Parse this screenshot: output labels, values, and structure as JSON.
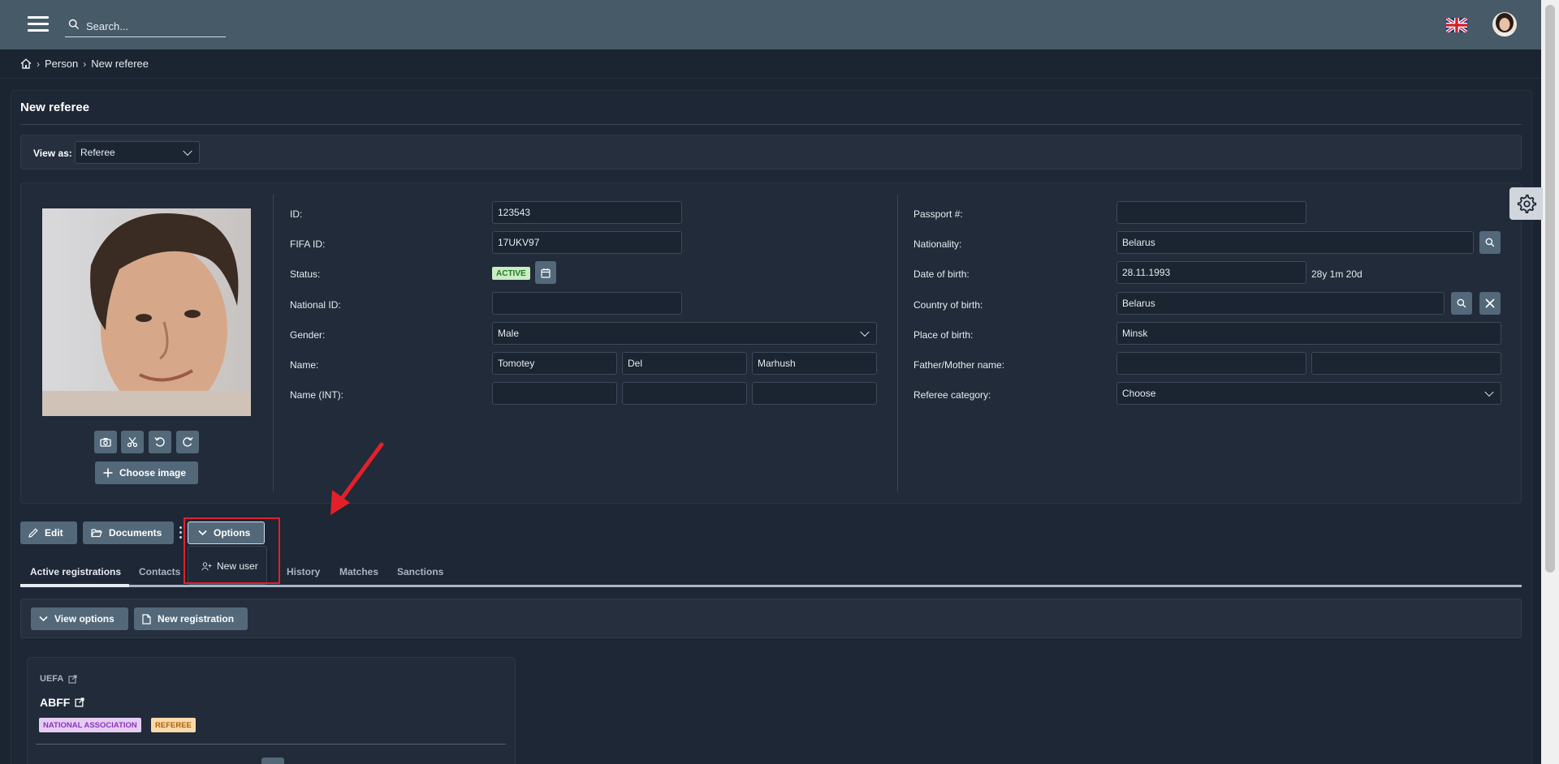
{
  "header": {
    "search_placeholder": "Search...",
    "flag_icon": "uk-flag-icon"
  },
  "breadcrumb": {
    "home_icon": "home-icon",
    "items": [
      "Person",
      "New referee"
    ]
  },
  "page": {
    "title": "New referee",
    "view_as_label": "View as:",
    "view_as_value": "Referee"
  },
  "photo": {
    "choose_image_label": "Choose image"
  },
  "left_fields": {
    "id_label": "ID:",
    "id_value": "123543",
    "fifa_label": "FIFA ID:",
    "fifa_value": "17UKV97",
    "status_label": "Status:",
    "status_value": "ACTIVE",
    "national_id_label": "National ID:",
    "national_id_value": "",
    "gender_label": "Gender:",
    "gender_value": "Male",
    "name_label": "Name:",
    "name_first": "Tomotey",
    "name_middle": "Del",
    "name_last": "Marhush",
    "name_int_label": "Name (INT):"
  },
  "right_fields": {
    "passport_label": "Passport #:",
    "passport_value": "",
    "nationality_label": "Nationality:",
    "nationality_value": "Belarus",
    "dob_label": "Date of birth:",
    "dob_value": "28.11.1993",
    "age_value": "28y 1m 20d",
    "cob_label": "Country of birth:",
    "cob_value": "Belarus",
    "pob_label": "Place of birth:",
    "pob_value": "Minsk",
    "parent_label": "Father/Mother name:",
    "category_label": "Referee category:",
    "category_value": "Choose"
  },
  "actions": {
    "edit": "Edit",
    "documents": "Documents",
    "options": "Options",
    "dropdown_new_user": "New user"
  },
  "tabs": [
    "Active registrations",
    "Contacts",
    "History",
    "Matches",
    "Sanctions"
  ],
  "sub_actions": {
    "view_options": "View options",
    "new_registration": "New registration"
  },
  "registration": {
    "org": "UEFA",
    "association": "ABFF",
    "tags": [
      "NATIONAL ASSOCIATION",
      "REFEREE"
    ]
  },
  "colors": {
    "topbar": "#465a68",
    "background": "#1b2431",
    "button": "#53697a",
    "annotation_red": "#e3202a"
  }
}
